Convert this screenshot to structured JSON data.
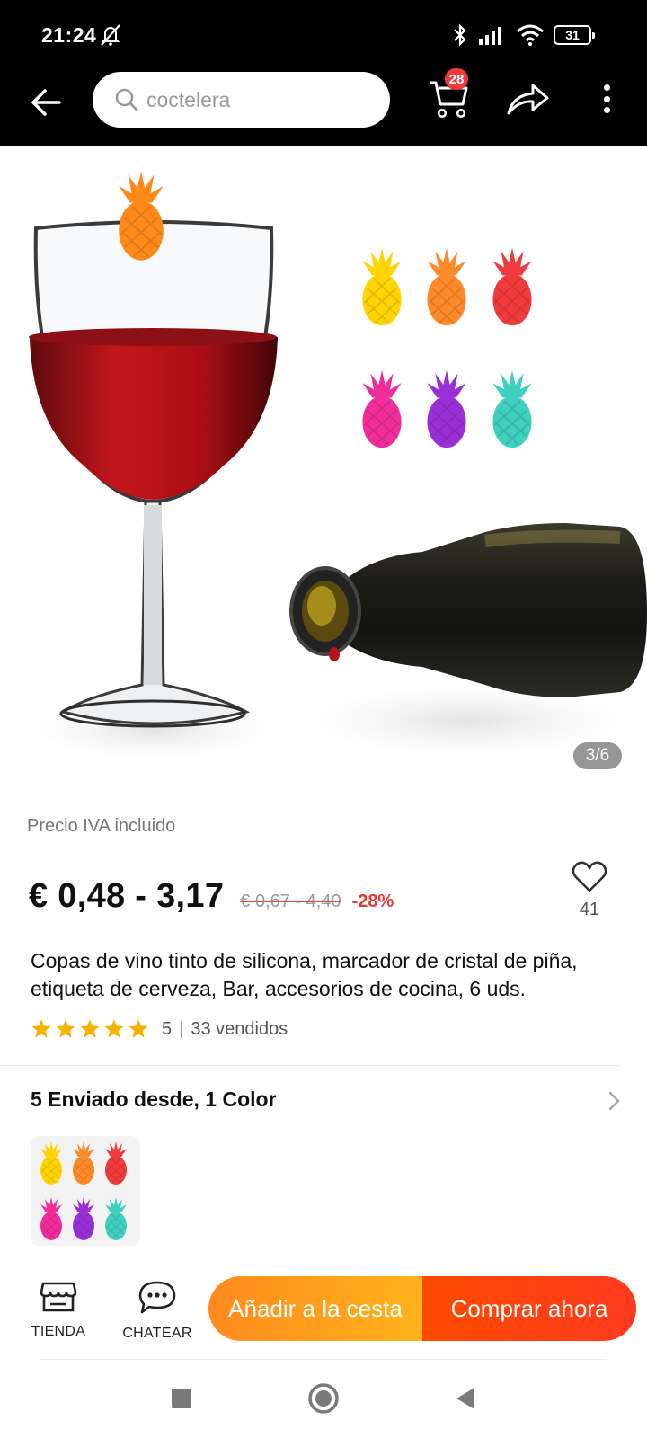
{
  "status_bar": {
    "time": "21:24",
    "battery": "31"
  },
  "search": {
    "placeholder": "coctelera"
  },
  "cart": {
    "badge_count": "28"
  },
  "image": {
    "counter": "3/6"
  },
  "price": {
    "vat_label": "Precio IVA incluido",
    "current": "€ 0,48 - 3,17",
    "original": "€ 0,67 - 4,40",
    "discount": "-28%"
  },
  "wishlist": {
    "count": "41"
  },
  "product": {
    "title": "Copas de vino tinto de silicona, marcador de cristal de piña, etiqueta de cerveza, Bar, accesorios de cocina, 6 uds.",
    "rating": "5",
    "rating_stars": 5,
    "sold": "33 vendidos"
  },
  "variants": {
    "title": "5 Enviado desde, 1 Color"
  },
  "bottom_bar": {
    "store_label": "TIENDA",
    "chat_label": "CHATEAR",
    "add_to_cart": "Añadir a la cesta",
    "buy_now": "Comprar ahora"
  },
  "colors": {
    "accent_orange": "#ff9a1a",
    "accent_red": "#ff4510",
    "star": "#f5b300",
    "discount": "#e63a36"
  },
  "pineapple_colors": [
    "#ffd400",
    "#ff8a2a",
    "#ef3b3b",
    "#f02d9a",
    "#9b2fd6",
    "#3fd0c0"
  ]
}
